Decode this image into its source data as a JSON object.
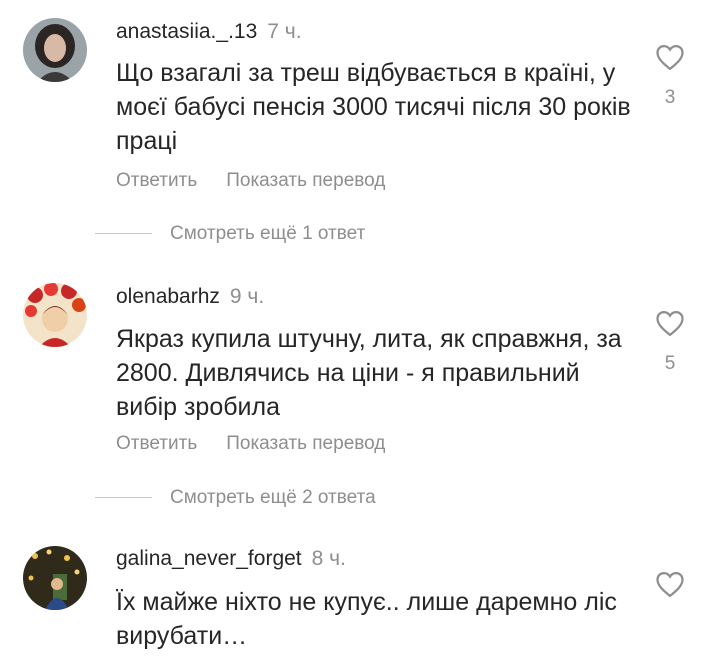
{
  "comments": [
    {
      "username": "anastasiia._.13",
      "time": "7 ч.",
      "text": "Що взагалі за треш відбувається в країні, у моєї бабусі пенсія 3000 тисячі після 30 років праці",
      "reply": "Ответить",
      "translate": "Показать перевод",
      "likes": "3",
      "view_replies": "Смотреть ещё 1 ответ"
    },
    {
      "username": "olenabarhz",
      "time": "9 ч.",
      "text": "Якраз купила штучну, лита, як справжня, за 2800. Дивлячись на ціни - я правильний вибір зробила",
      "reply": "Ответить",
      "translate": "Показать перевод",
      "likes": "5",
      "view_replies": "Смотреть ещё 2 ответа"
    },
    {
      "username": "galina_never_forget",
      "time": "8 ч.",
      "text": "Їх майже ніхто не купує.. лише даремно ліс вирубати…"
    }
  ],
  "icons": {
    "like": "heart-outline-icon"
  },
  "colors": {
    "primary_text": "#262626",
    "secondary_text": "#8e8e8e",
    "divider": "#c7c7c7"
  }
}
